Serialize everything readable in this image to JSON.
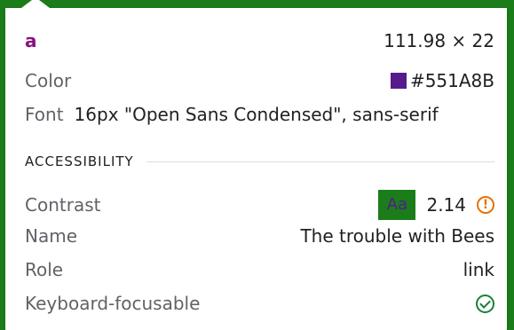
{
  "element": {
    "tag": "a",
    "dimensions": "111.98 × 22"
  },
  "color": {
    "label": "Color",
    "value": "#551A8B",
    "swatch": "#551A8B"
  },
  "font": {
    "label": "Font",
    "value": "16px \"Open Sans Condensed\", sans-serif"
  },
  "accessibility": {
    "heading": "ACCESSIBILITY",
    "contrast": {
      "label": "Contrast",
      "sample": "Aa",
      "sample_bg": "#1a7d1a",
      "sample_fg": "#551A8B",
      "ratio": "2.14",
      "icon": "warning-icon"
    },
    "name": {
      "label": "Name",
      "value": "The trouble with Bees"
    },
    "role": {
      "label": "Role",
      "value": "link"
    },
    "keyboard": {
      "label": "Keyboard-focusable",
      "icon": "check-circle-icon"
    }
  },
  "colors": {
    "frame": "#1a7d1a",
    "warning": "#e8710a",
    "success": "#188038",
    "tag": "#881280"
  }
}
